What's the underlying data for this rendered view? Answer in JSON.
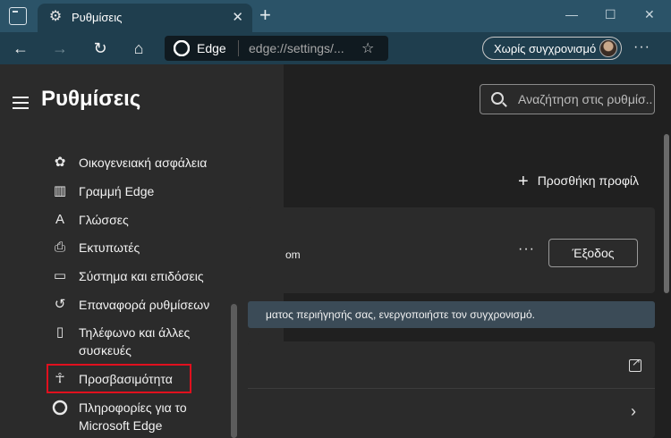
{
  "browser": {
    "tab": {
      "title": "Ρυθμίσεις",
      "icon": "gear-icon"
    },
    "address": {
      "brand": "Edge",
      "url": "edge://settings/..."
    },
    "sync_button": {
      "label": "Χωρίς συγχρονισμό"
    },
    "window_controls": {
      "minimize": "—",
      "maximize": "☐",
      "close": "✕"
    }
  },
  "sidebar": {
    "title": "Ρυθμίσεις",
    "items": [
      {
        "label": "Οικογενειακή ασφάλεια",
        "icon": "family-icon"
      },
      {
        "label": "Γραμμή Edge",
        "icon": "edge-bar-icon"
      },
      {
        "label": "Γλώσσες",
        "icon": "languages-icon"
      },
      {
        "label": "Εκτυπωτές",
        "icon": "printer-icon"
      },
      {
        "label": "Σύστημα και επιδόσεις",
        "icon": "laptop-icon"
      },
      {
        "label": "Επαναφορά ρυθμίσεων",
        "icon": "reset-icon"
      },
      {
        "label": "Τηλέφωνο και άλλες συσκευές",
        "icon": "phone-icon"
      },
      {
        "label": "Προσβασιμότητα",
        "icon": "accessibility-icon",
        "highlighted": true
      },
      {
        "label": "Πληροφορίες για το Microsoft Edge",
        "icon": "edge-logo-icon"
      }
    ]
  },
  "main": {
    "search": {
      "placeholder": "Αναζήτηση στις ρυθμίσ..."
    },
    "add_profile_label": "Προσθήκη προφίλ",
    "account_text_fragment": "om",
    "signout_label": "Έξοδος",
    "sync_notice_fragment": "ματος περιήγησής σας, ενεργοποιήστε τον συγχρονισμό."
  },
  "colors": {
    "tab_bar": "#2b5368",
    "toolbar": "#1f3e4e",
    "sidebar": "#2b2b2b",
    "content": "#202020",
    "highlight_border": "#e0101e"
  }
}
